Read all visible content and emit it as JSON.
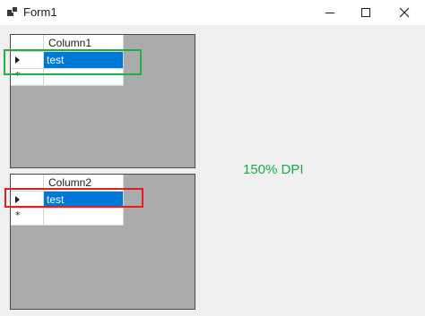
{
  "window": {
    "title": "Form1"
  },
  "grid1": {
    "column_header": "Column1",
    "rows": [
      {
        "indicator": "current",
        "value": "test"
      }
    ],
    "new_row_glyph": "*"
  },
  "grid2": {
    "column_header": "Column2",
    "rows": [
      {
        "indicator": "current",
        "value": "test"
      }
    ],
    "new_row_glyph": "*"
  },
  "annotation": {
    "label": "150% DPI"
  },
  "colors": {
    "selection": "#0078d7",
    "grid_background": "#ababab",
    "green_highlight": "#20b040",
    "red_highlight": "#e02020",
    "annotation_text": "#22a845"
  }
}
